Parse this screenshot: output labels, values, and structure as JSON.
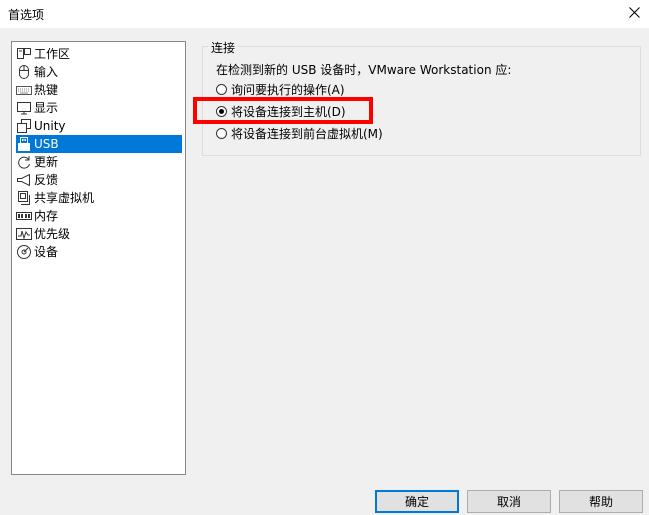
{
  "window": {
    "title": "首选项"
  },
  "nav": {
    "items": [
      {
        "label": "工作区",
        "icon": "workspace-icon"
      },
      {
        "label": "输入",
        "icon": "mouse-icon"
      },
      {
        "label": "热键",
        "icon": "keyboard-icon"
      },
      {
        "label": "显示",
        "icon": "monitor-icon"
      },
      {
        "label": "Unity",
        "icon": "unity-icon"
      },
      {
        "label": "USB",
        "icon": "usb-icon"
      },
      {
        "label": "更新",
        "icon": "refresh-icon"
      },
      {
        "label": "反馈",
        "icon": "megaphone-icon"
      },
      {
        "label": "共享虚拟机",
        "icon": "shared-vm-icon"
      },
      {
        "label": "内存",
        "icon": "memory-icon"
      },
      {
        "label": "优先级",
        "icon": "priority-icon"
      },
      {
        "label": "设备",
        "icon": "device-icon"
      }
    ],
    "selected": "USB"
  },
  "connection": {
    "legend": "连接",
    "description": "在检测到新的 USB 设备时，VMware Workstation 应:",
    "options": [
      {
        "label": "询问要执行的操作(A)"
      },
      {
        "label": "将设备连接到主机(D)"
      },
      {
        "label": "将设备连接到前台虚拟机(M)"
      }
    ],
    "selected_option": "将设备连接到主机(D)"
  },
  "buttons": {
    "ok": "确定",
    "cancel": "取消",
    "help": "帮助"
  },
  "colors": {
    "selection": "#0078d7",
    "highlight": "#ff0000"
  }
}
